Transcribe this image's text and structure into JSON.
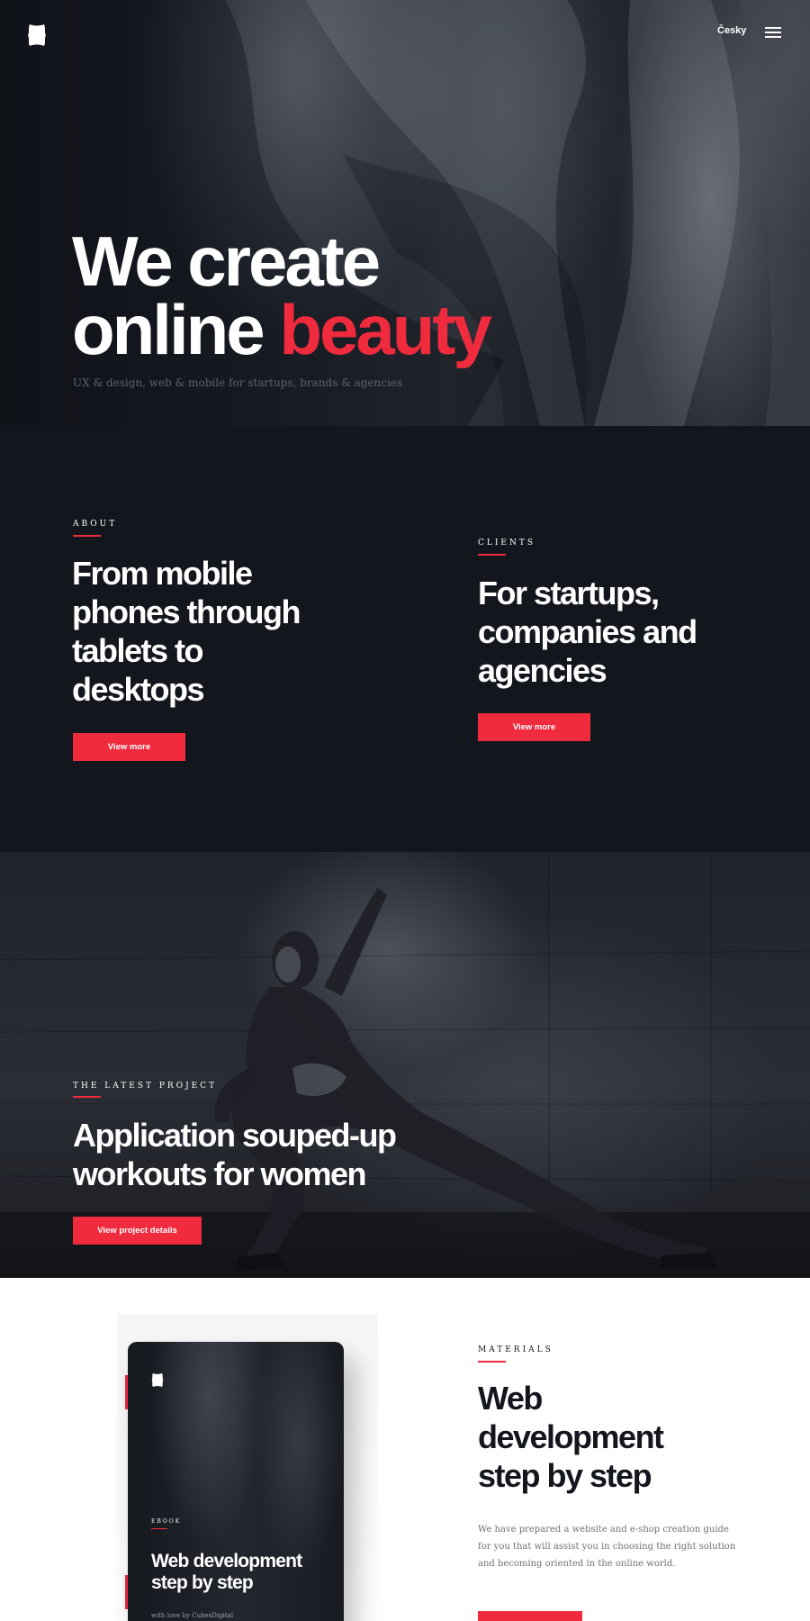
{
  "header": {
    "logo": "shield-logo",
    "language_label": "Česky",
    "menu_icon": "hamburger-menu-icon"
  },
  "hero": {
    "title_line1": "We create",
    "title_line2_plain": "online",
    "title_line2_accent": "beauty",
    "subtitle": "UX & design, web & mobile for startups, brands & agencies"
  },
  "about": {
    "eyebrow": "ABOUT",
    "heading_lines": [
      "From mobile",
      "phones through",
      "tablets to",
      "desktops"
    ],
    "button_label": "View more"
  },
  "clients": {
    "eyebrow": "CLIENTS",
    "heading_lines": [
      "For startups,",
      "companies and",
      "agencies"
    ],
    "button_label": "View more"
  },
  "project": {
    "eyebrow": "THE LATEST PROJECT",
    "heading_lines": [
      "Application souped-up",
      "workouts for women"
    ],
    "button_label": "View project details"
  },
  "materials": {
    "eyebrow": "MATERIALS",
    "heading_lines": [
      "Web",
      "development",
      "step by step"
    ],
    "body": "We have prepared a website and e-shop creation guide for you that will assist you in choosing the right solution and becoming oriented in the online world.",
    "book": {
      "eyebrow": "EBOOK",
      "title_lines": [
        "Web development",
        "step by step"
      ],
      "credit": "with love by CubesDigital"
    }
  },
  "colors": {
    "accent": "#f02b3e",
    "dark_bg": "#13171d",
    "light_bg": "#ffffff"
  }
}
